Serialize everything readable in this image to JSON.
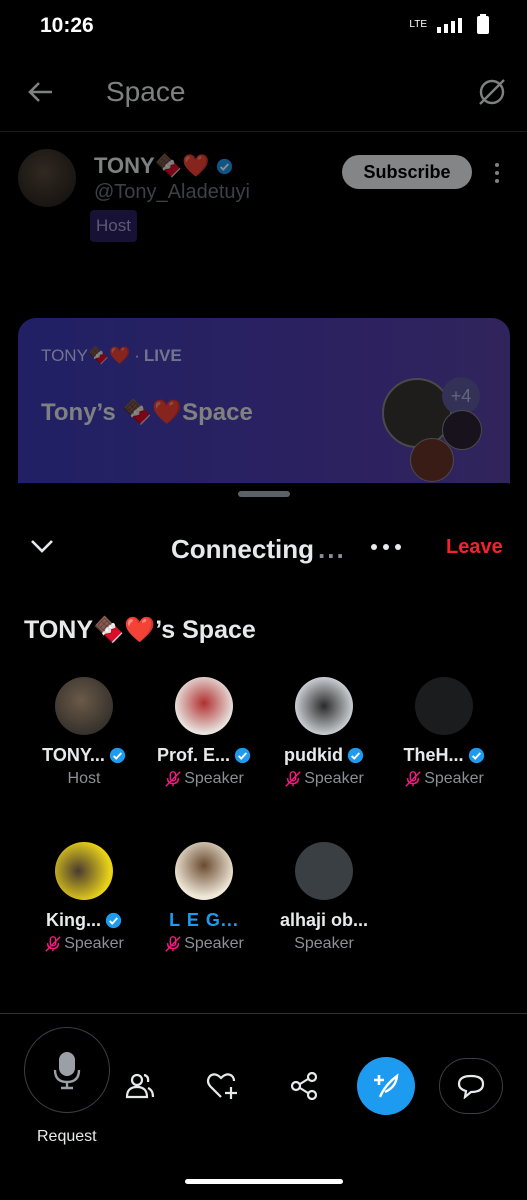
{
  "status_bar": {
    "time": "10:26",
    "network": "LTE"
  },
  "header": {
    "title": "Space"
  },
  "host": {
    "name": "TONY🍫❤️",
    "handle": "@Tony_Aladetuyi",
    "badge": "Host",
    "subscribe_label": "Subscribe"
  },
  "card": {
    "meta": "TONY🍫❤️",
    "live": "LIVE",
    "title": "Tony’s 🍫❤️Space",
    "extra_count": "+4"
  },
  "controls": {
    "status": "Connecting",
    "leave_label": "Leave"
  },
  "space": {
    "title": "TONY🍫❤️’s Space"
  },
  "participants": [
    {
      "name": "TONY...",
      "role": "Host"
    },
    {
      "name": "Prof. E...",
      "role": "Speaker"
    },
    {
      "name": "pudkid",
      "role": "Speaker"
    },
    {
      "name": "TheH...",
      "role": "Speaker"
    },
    {
      "name": "King...",
      "role": "Speaker"
    },
    {
      "name": "L E G...",
      "role": "Speaker"
    },
    {
      "name": "alhaji ob...",
      "role": "Speaker"
    }
  ],
  "bottom": {
    "request_label": "Request"
  },
  "colors": {
    "verified": "#1d9bf0",
    "leave": "#f4212e",
    "mute": "#f91880",
    "card": "#3c3bb8"
  }
}
